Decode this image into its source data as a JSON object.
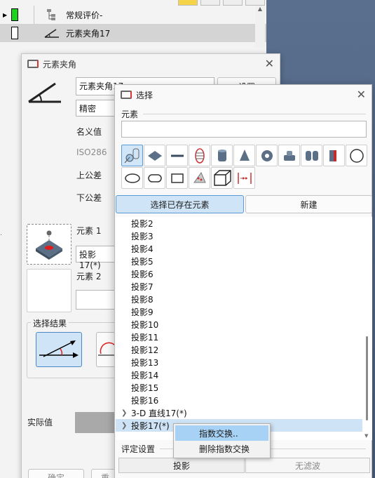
{
  "tree": {
    "rows": [
      {
        "label": "常规评价-",
        "status": "green"
      },
      {
        "label": "元素夹角17",
        "status": "white"
      }
    ]
  },
  "dialog_angle": {
    "title": "元素夹角",
    "name_value": "元素夹角17",
    "settings_button": "设置",
    "mode_value": "精密",
    "nominal_label": "名义值",
    "iso_label": "ISO286",
    "upper_tol_label": "上公差",
    "lower_tol_label": "下公差",
    "element1_label": "元素 1",
    "element1_value": "投影17(*)",
    "element2_label": "元素 2",
    "element2_value": "",
    "result_group_title": "选择结果",
    "actual_label": "实际值",
    "ok_button": "确定",
    "reset_button": "重"
  },
  "dialog_select": {
    "title": "选择",
    "element_group": "元素",
    "search_value": "",
    "tools": [
      "point-icon",
      "plane-icon",
      "line-icon",
      "circle-3d-icon",
      "cylinder-icon",
      "cone-icon",
      "torus-icon",
      "step-cylinder-icon",
      "double-cylinder-icon",
      "slot-icon",
      "circle-icon",
      "ellipse-icon",
      "rounded-slot-icon",
      "rectangle-icon",
      "point-cloud-icon",
      "box-icon",
      "distance-icon"
    ],
    "tab_existing": "选择已存在元素",
    "tab_new": "新建",
    "list_items": [
      "投影2",
      "投影3",
      "投影4",
      "投影5",
      "投影6",
      "投影7",
      "投影8",
      "投影9",
      "投影10",
      "投影11",
      "投影12",
      "投影13",
      "投影14",
      "投影15",
      "投影16"
    ],
    "expandable_items": [
      "3-D 直线17(*)",
      "投影17(*)"
    ],
    "eval_group": "评定设置",
    "bottom_left": "投影",
    "bottom_right": "无滤波"
  },
  "context_menu": {
    "items": [
      "指数交换..",
      "删除指数交换"
    ]
  },
  "colors": {
    "selection_blue": "#cfe4f7",
    "status_green": "#1bd41b",
    "menu_highlight": "#a8d2f5"
  }
}
